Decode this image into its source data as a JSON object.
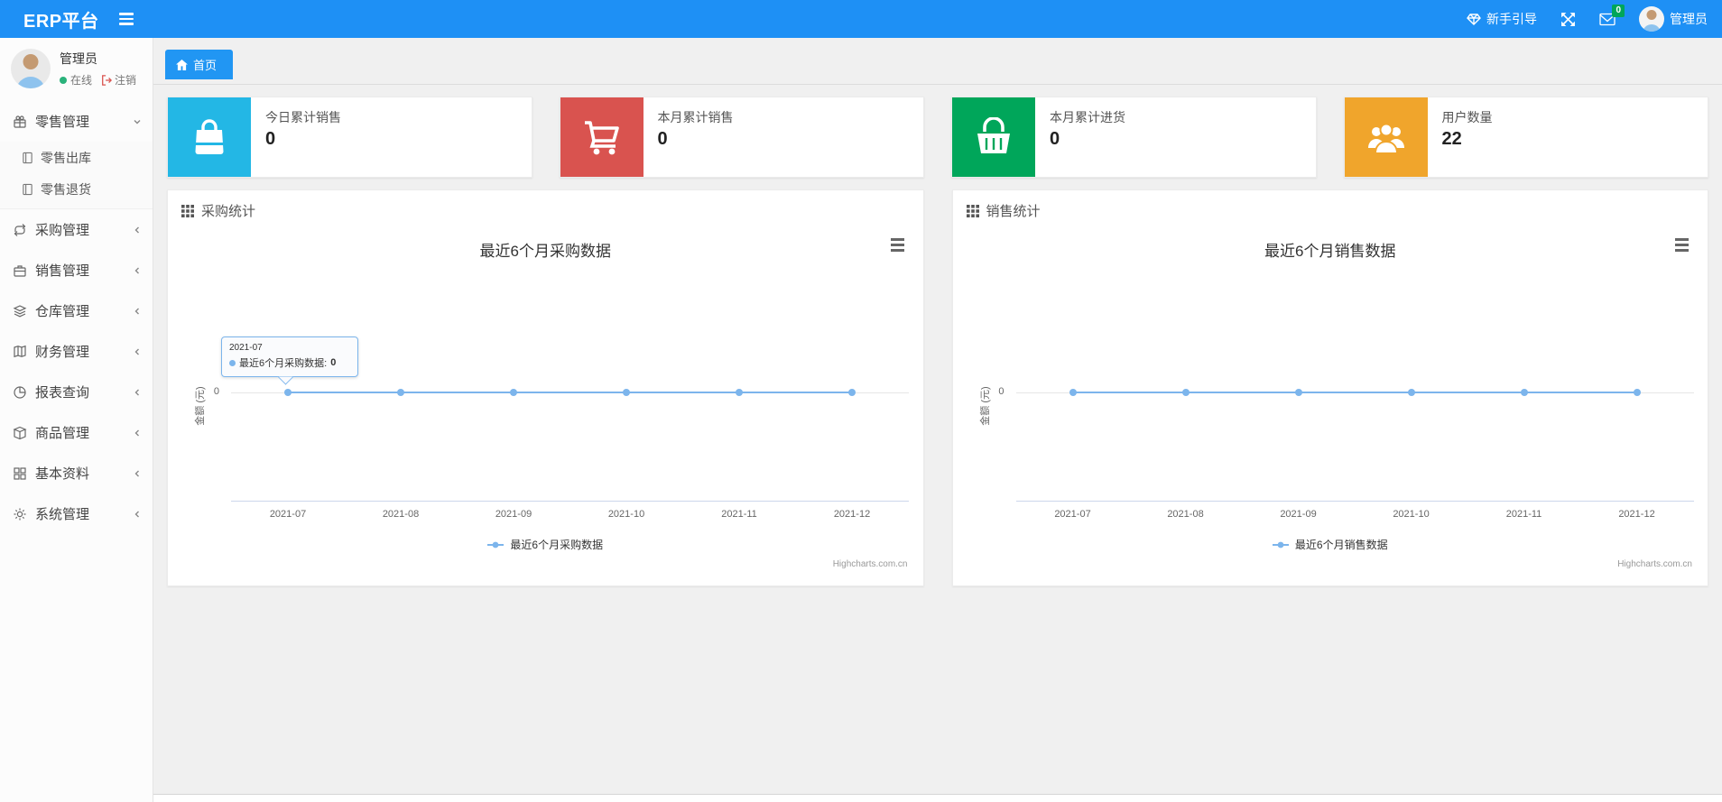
{
  "navbar": {
    "brand": "ERP平台",
    "guide_label": "新手引导",
    "message_badge": "0",
    "username": "管理员"
  },
  "sidebar": {
    "user": {
      "name": "管理员",
      "status": "在线",
      "logout": "注销"
    },
    "menu": [
      {
        "label": "零售管理"
      },
      {
        "label": "零售出库"
      },
      {
        "label": "零售退货"
      },
      {
        "label": "采购管理"
      },
      {
        "label": "销售管理"
      },
      {
        "label": "仓库管理"
      },
      {
        "label": "财务管理"
      },
      {
        "label": "报表查询"
      },
      {
        "label": "商品管理"
      },
      {
        "label": "基本资料"
      },
      {
        "label": "系统管理"
      }
    ]
  },
  "breadcrumb": {
    "home": "首页"
  },
  "stat_cards": [
    {
      "label": "今日累计销售",
      "value": "0",
      "color": "#23b7e5",
      "icon": "shopping-bag-icon"
    },
    {
      "label": "本月累计销售",
      "value": "0",
      "color": "#d9534f",
      "icon": "shopping-cart-icon"
    },
    {
      "label": "本月累计进货",
      "value": "0",
      "color": "#00a65a",
      "icon": "shopping-basket-icon"
    },
    {
      "label": "用户数量",
      "value": "22",
      "color": "#f0a52c",
      "icon": "users-icon"
    }
  ],
  "panels": [
    {
      "header": "采购统计"
    },
    {
      "header": "销售统计"
    }
  ],
  "chart_data": [
    {
      "type": "line",
      "title": "最近6个月采购数据",
      "categories": [
        "2021-07",
        "2021-08",
        "2021-09",
        "2021-10",
        "2021-11",
        "2021-12"
      ],
      "series": [
        {
          "name": "最近6个月采购数据",
          "values": [
            0,
            0,
            0,
            0,
            0,
            0
          ]
        }
      ],
      "ylabel": "金额 (元)",
      "yticks": [
        "0"
      ],
      "ylim": [
        -1,
        1
      ],
      "grid": true,
      "legend_position": "bottom",
      "line_color": "#7cb5ec",
      "credits": "Highcharts.com.cn",
      "tooltip": {
        "visible": true,
        "category": "2021-07",
        "label": "最近6个月采购数据: ",
        "value": "0"
      }
    },
    {
      "type": "line",
      "title": "最近6个月销售数据",
      "categories": [
        "2021-07",
        "2021-08",
        "2021-09",
        "2021-10",
        "2021-11",
        "2021-12"
      ],
      "series": [
        {
          "name": "最近6个月销售数据",
          "values": [
            0,
            0,
            0,
            0,
            0,
            0
          ]
        }
      ],
      "ylabel": "金额 (元)",
      "yticks": [
        "0"
      ],
      "ylim": [
        -1,
        1
      ],
      "grid": true,
      "legend_position": "bottom",
      "line_color": "#7cb5ec",
      "credits": "Highcharts.com.cn",
      "tooltip": {
        "visible": false
      }
    }
  ]
}
